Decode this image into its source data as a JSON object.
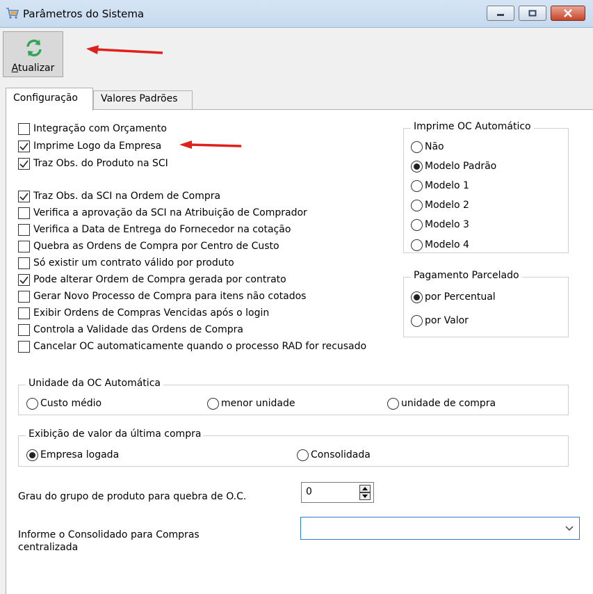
{
  "window": {
    "title": "Parâmetros do Sistema"
  },
  "toolbar": {
    "refresh_label": "Atualizar"
  },
  "tabs": [
    {
      "label": "Configuração",
      "active": true
    },
    {
      "label": "Valores Padrões",
      "active": false
    }
  ],
  "options": [
    {
      "label": "Integração com Orçamento",
      "checked": false
    },
    {
      "label": "Imprime Logo da Empresa",
      "checked": true
    },
    {
      "label": "Traz Obs. do Produto na SCI",
      "checked": true
    },
    {
      "label": "Traz Obs. da SCI na Ordem de Compra",
      "checked": true
    },
    {
      "label": "Verifica a aprovação da SCI na Atribuição de Comprador",
      "checked": false
    },
    {
      "label": "Verifica a Data de Entrega do Fornecedor na cotação",
      "checked": false
    },
    {
      "label": "Quebra as Ordens de Compra por Centro de Custo",
      "checked": false
    },
    {
      "label": "Só existir um contrato válido por produto",
      "checked": false
    },
    {
      "label": "Pode alterar Ordem de Compra gerada por contrato",
      "checked": true
    },
    {
      "label": "Gerar Novo Processo de Compra para itens não cotados",
      "checked": false
    },
    {
      "label": "Exibir Ordens de Compras Vencidas após o login",
      "checked": false
    },
    {
      "label": "Controla a Validade das Ordens de Compra",
      "checked": false
    },
    {
      "label": "Cancelar OC automaticamente quando o processo RAD for recusado",
      "checked": false
    }
  ],
  "imprime_oc": {
    "title": "Imprime OC Automático",
    "options": [
      "Não",
      "Modelo Padrão",
      "Modelo 1",
      "Modelo 2",
      "Modelo 3",
      "Modelo 4"
    ],
    "selected": "Modelo Padrão"
  },
  "pagamento": {
    "title": "Pagamento Parcelado",
    "options": [
      "por Percentual",
      "por Valor"
    ],
    "selected": "por Percentual"
  },
  "unidade": {
    "title": "Unidade da OC Automática",
    "options": [
      "Custo médio",
      "menor unidade",
      "unidade de compra"
    ],
    "selected": ""
  },
  "exibicao": {
    "title": "Exibição de valor da última compra",
    "options": [
      "Empresa logada",
      "Consolidada"
    ],
    "selected": "Empresa logada"
  },
  "grau": {
    "label": "Grau do grupo de produto para quebra de O.C.",
    "value": "0"
  },
  "consolidado": {
    "label_line1": "Informe o Consolidado para Compras",
    "label_line2": "centralizada",
    "value": ""
  },
  "colors": {
    "refresh_icon": "#2fa55a",
    "arrow": "#e0201b",
    "focus_border": "#2c7ad6"
  }
}
